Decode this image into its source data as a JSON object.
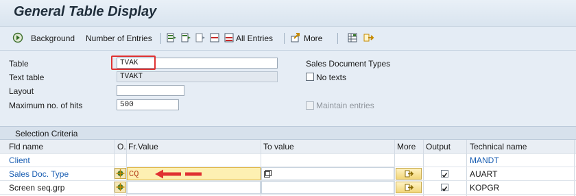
{
  "window": {
    "title": "General Table Display"
  },
  "toolbar": {
    "background": "Background",
    "number_of_entries": "Number of Entries",
    "all_entries": "All Entries",
    "more": "More"
  },
  "form": {
    "table_label": "Table",
    "table_value": "TVAK",
    "text_table_label": "Text table",
    "text_table_value": "TVAKT",
    "layout_label": "Layout",
    "layout_value": "",
    "max_hits_label": "Maximum no. of hits",
    "max_hits_value": "500",
    "description": "Sales Document Types",
    "no_texts_label": "No texts",
    "maintain_entries_label": "Maintain entries"
  },
  "selection": {
    "title": "Selection Criteria",
    "columns": {
      "fld_name": "Fld name",
      "o": "O.",
      "fr_value": "Fr.Value",
      "to_value": "To value",
      "more": "More",
      "output": "Output",
      "technical_name": "Technical name"
    },
    "rows": [
      {
        "fld_name": "Client",
        "fr_value": "",
        "technical_name": "MANDT"
      },
      {
        "fld_name": "Sales Doc. Type",
        "fr_value": "CQ",
        "technical_name": "AUART"
      },
      {
        "fld_name": "Screen seq.grp",
        "fr_value": "",
        "technical_name": "KOPGR"
      }
    ]
  },
  "colors": {
    "annotation_red": "#e03131",
    "link_blue": "#1b5fb3",
    "highlight_yellow": "#fdf0b2"
  },
  "icons": [
    "execute-background-icon",
    "column-select-icon",
    "delete-row-icon",
    "export-icon",
    "arrow-right-icon",
    "operator-icon",
    "multiple-selection-icon",
    "checkbox-icon"
  ]
}
